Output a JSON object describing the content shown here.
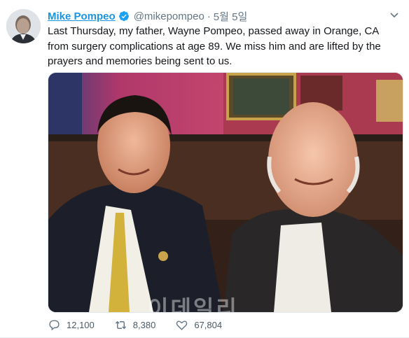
{
  "tweet": {
    "author_name": "Mike Pompeo",
    "handle": "@mikepompeo",
    "separator": "·",
    "timestamp": "5월 5일",
    "verified_icon": "verified-badge-icon",
    "text": "Last Thursday, my father, Wayne Pompeo, passed away in Orange, CA from surgery complications at age 89. We miss him and are lifted by the prayers and memories being sent to us.",
    "media": {
      "watermark": "이데일리"
    },
    "actions": {
      "reply_count": "12,100",
      "retweet_count": "8,380",
      "like_count": "67,804"
    }
  },
  "colors": {
    "accent": "#1b95e0",
    "text": "#14171a",
    "muted": "#657786"
  }
}
